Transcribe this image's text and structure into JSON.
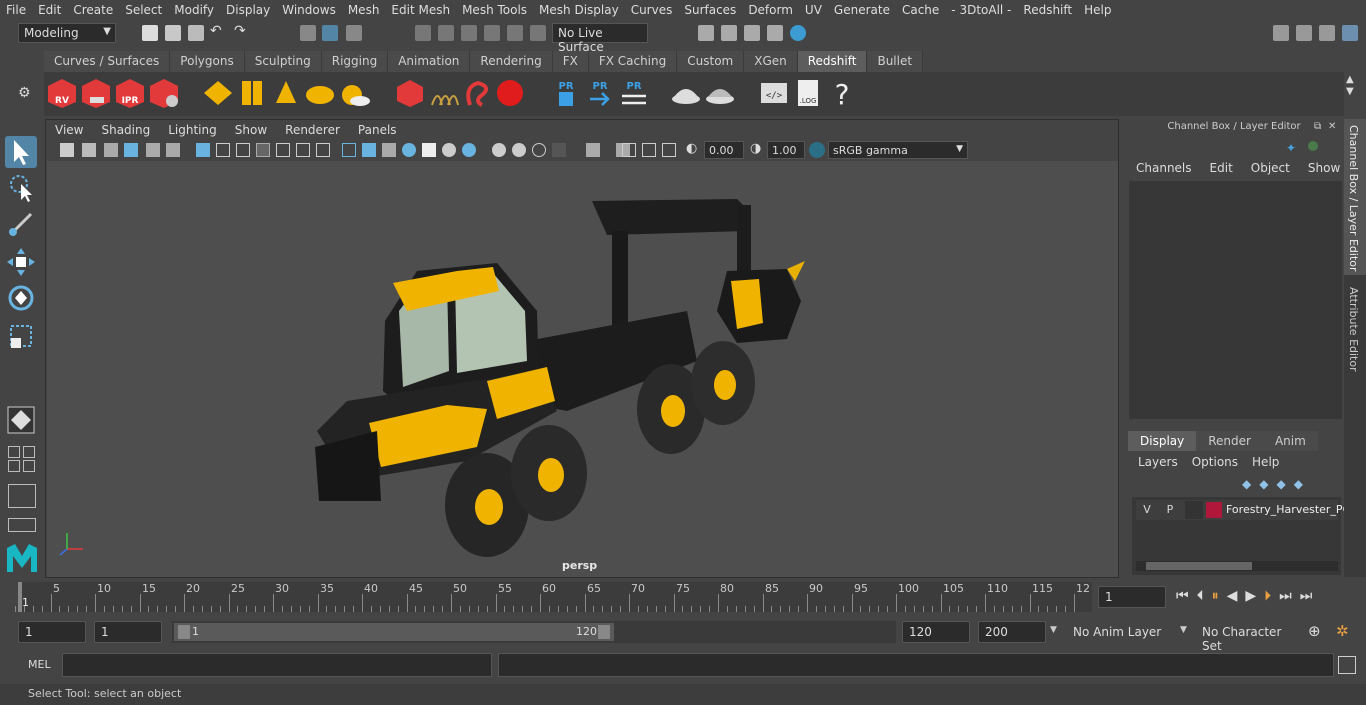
{
  "menu": [
    "File",
    "Edit",
    "Create",
    "Select",
    "Modify",
    "Display",
    "Windows",
    "Mesh",
    "Edit Mesh",
    "Mesh Tools",
    "Mesh Display",
    "Curves",
    "Surfaces",
    "Deform",
    "UV",
    "Generate",
    "Cache",
    "- 3DtoAll -",
    "Redshift",
    "Help"
  ],
  "status": {
    "mode": "Modeling",
    "live_surface": "No Live Surface"
  },
  "shelf_tabs": [
    "Curves / Surfaces",
    "Polygons",
    "Sculpting",
    "Rigging",
    "Animation",
    "Rendering",
    "FX",
    "FX Caching",
    "Custom",
    "XGen",
    "Redshift",
    "Bullet"
  ],
  "shelf_active": "Redshift",
  "shelf_labels": {
    "rv": "RV",
    "ipr": "IPR",
    "pr": "PR",
    "log": ".LOG",
    "help": "?"
  },
  "viewport": {
    "menus": [
      "View",
      "Shading",
      "Lighting",
      "Show",
      "Renderer",
      "Panels"
    ],
    "exposure": "0.00",
    "gamma": "1.00",
    "colorspace": "sRGB gamma",
    "camera_label": "persp"
  },
  "right_panel": {
    "title": "Channel Box / Layer Editor",
    "menus": [
      "Channels",
      "Edit",
      "Object",
      "Show"
    ],
    "tabs": [
      "Display",
      "Render",
      "Anim"
    ],
    "active_tab": "Display",
    "layer_menus": [
      "Layers",
      "Options",
      "Help"
    ],
    "layer": {
      "v": "V",
      "p": "P",
      "name": "Forestry_Harvester_PO",
      "color": "#b0173a"
    },
    "side_tabs": [
      "Channel Box / Layer Editor",
      "Attribute Editor"
    ]
  },
  "timeline": {
    "ticks": [
      "5",
      "10",
      "15",
      "20",
      "25",
      "30",
      "35",
      "40",
      "45",
      "50",
      "55",
      "60",
      "65",
      "70",
      "75",
      "80",
      "85",
      "90",
      "95",
      "100",
      "105",
      "110",
      "115",
      "12"
    ],
    "start_marker": "1",
    "current_frame": "1"
  },
  "range": {
    "start": "1",
    "start2": "1",
    "slider_start": "1",
    "slider_end": "120",
    "end": "120",
    "end2": "200",
    "anim_layer": "No Anim Layer",
    "char_set": "No Character Set"
  },
  "mel": {
    "label": "MEL"
  },
  "help_line": "Select Tool: select an object",
  "colors": {
    "accent": "#5285a6",
    "redshift_red": "#e23a3a",
    "yellow": "#f0b400"
  }
}
